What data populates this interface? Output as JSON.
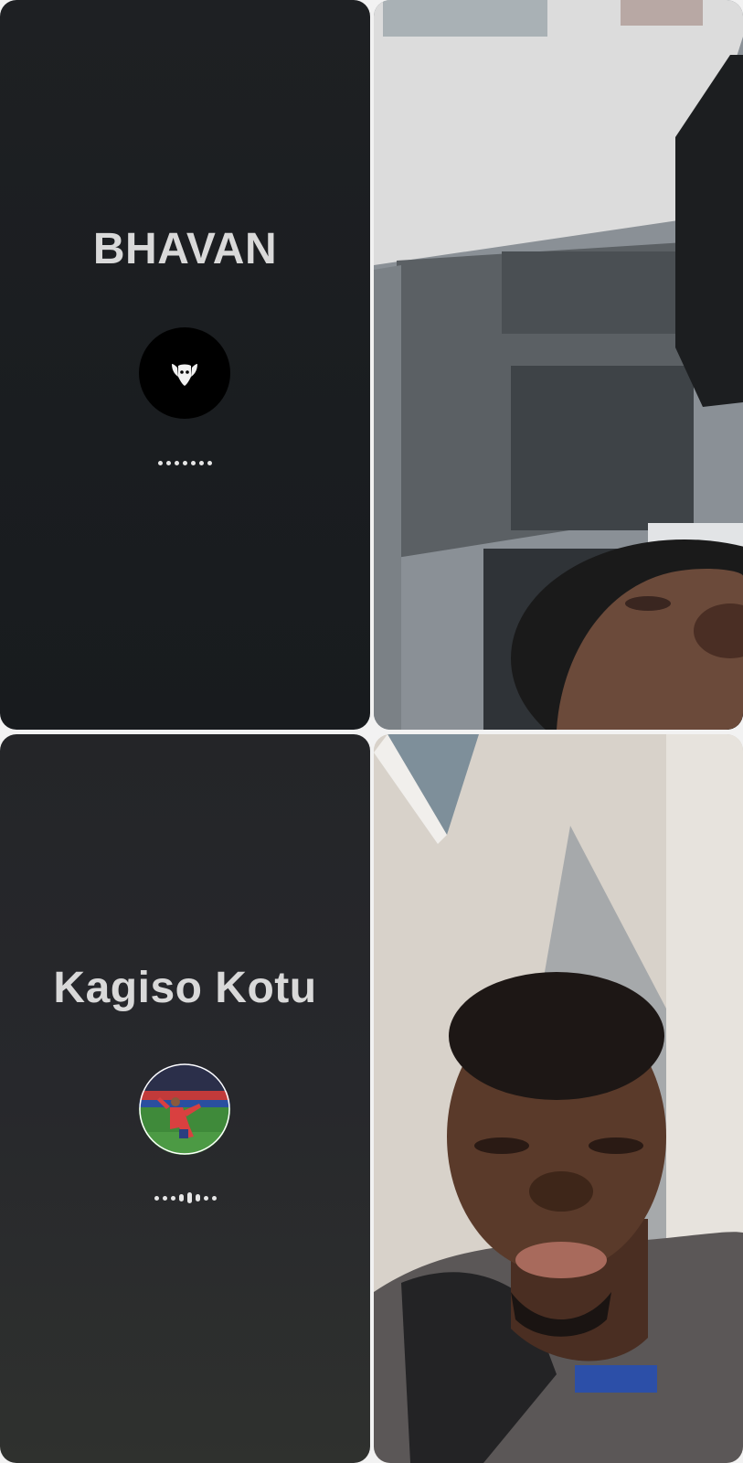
{
  "participants": [
    {
      "name": "BHAVAN",
      "avatar_icon": "horned-mask-icon",
      "audio_level": 0.0
    },
    {
      "name": "Kagiso Kotu",
      "avatar_icon": "football-player-photo-icon",
      "audio_level": 0.4
    }
  ],
  "video_feeds": [
    {
      "description_icon": "camera-feed-ceiling-icon"
    },
    {
      "description_icon": "camera-feed-selfie-icon"
    }
  ],
  "colors": {
    "tile_dark": "#1a1d20",
    "name_text": "#d9d9d9",
    "wave_dot": "#e6e6e6"
  }
}
